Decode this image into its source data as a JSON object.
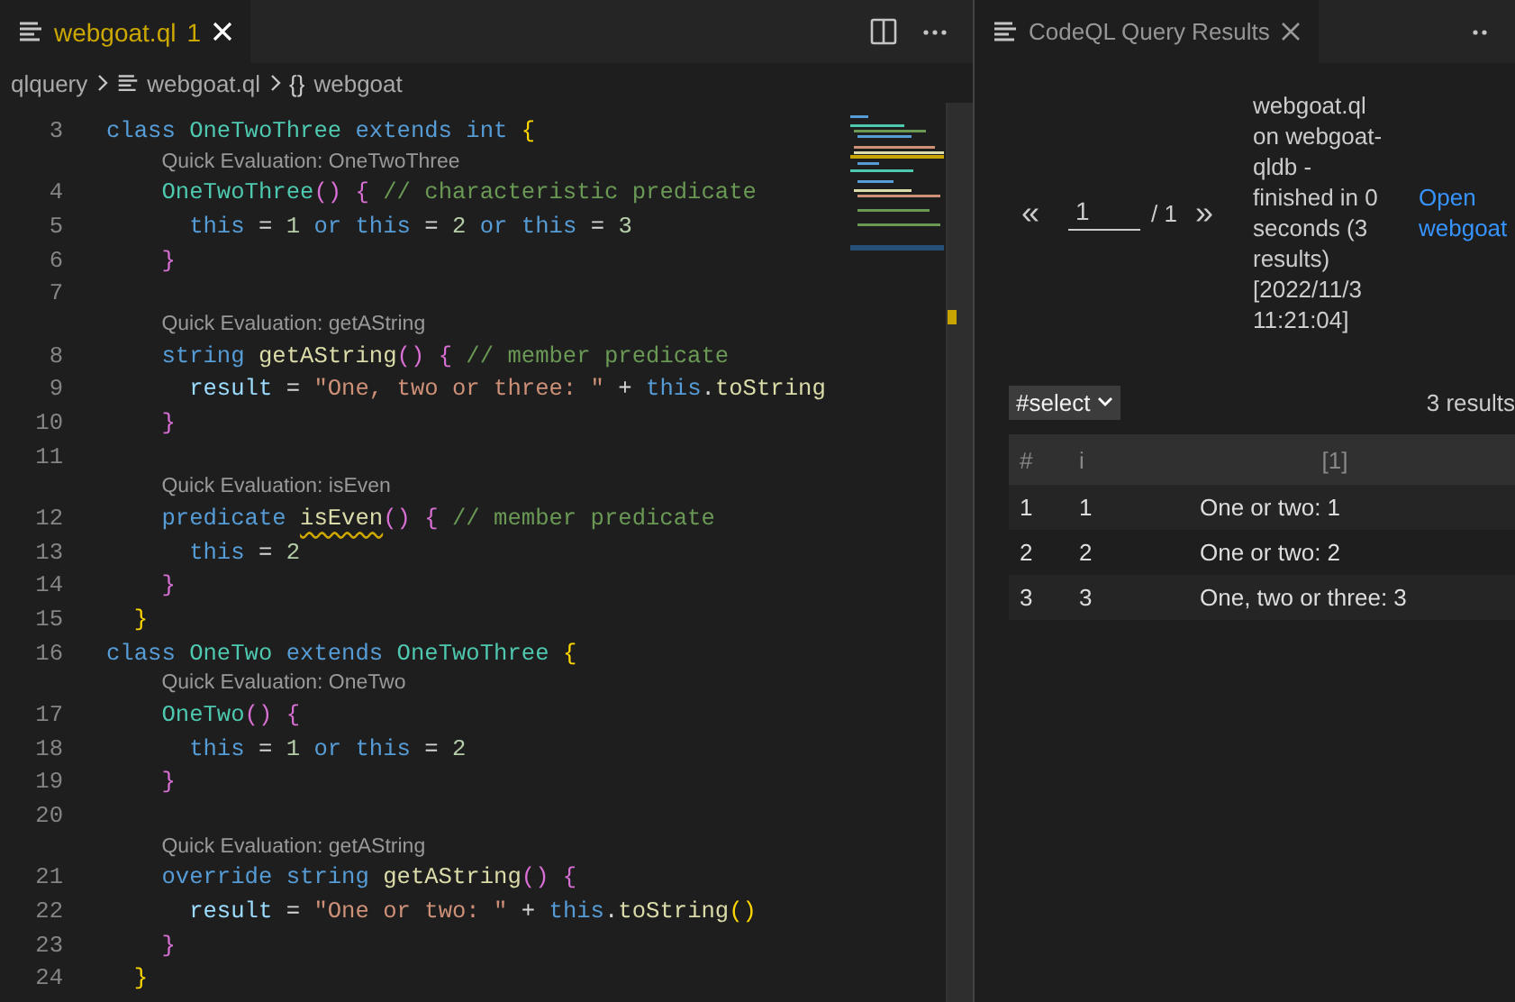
{
  "editor": {
    "tab": {
      "label": "webgoat.ql",
      "badge": "1",
      "selected": true
    },
    "breadcrumb": [
      {
        "kind": "folder",
        "label": "qlquery"
      },
      {
        "kind": "file",
        "label": "webgoat.ql"
      },
      {
        "kind": "symbol",
        "label": "webgoat",
        "glyph": "{}"
      }
    ],
    "lines": [
      {
        "kind": "code",
        "number": "3",
        "tokens": [
          {
            "kind": "keyword",
            "text": "class "
          },
          {
            "kind": "type",
            "text": "OneTwoThree "
          },
          {
            "kind": "keyword",
            "text": "extends int "
          },
          {
            "kind": "bracket1",
            "text": "{"
          }
        ]
      },
      {
        "kind": "lens",
        "text": "Quick Evaluation: OneTwoThree"
      },
      {
        "kind": "code",
        "number": "4",
        "tokens": [
          {
            "kind": "type",
            "text": "    OneTwoThree"
          },
          {
            "kind": "bracket2",
            "text": "() {"
          },
          {
            "kind": "comment",
            "text": " // characteristic predicate"
          }
        ]
      },
      {
        "kind": "code",
        "number": "5",
        "tokens": [
          {
            "kind": "keyword",
            "text": "      this"
          },
          {
            "kind": "plain",
            "text": " = "
          },
          {
            "kind": "number",
            "text": "1"
          },
          {
            "kind": "keyword",
            "text": " or this"
          },
          {
            "kind": "plain",
            "text": " = "
          },
          {
            "kind": "number",
            "text": "2"
          },
          {
            "kind": "keyword",
            "text": " or this"
          },
          {
            "kind": "plain",
            "text": " = "
          },
          {
            "kind": "number",
            "text": "3"
          }
        ]
      },
      {
        "kind": "code",
        "number": "6",
        "tokens": [
          {
            "kind": "bracket2",
            "text": "    }"
          }
        ]
      },
      {
        "kind": "code",
        "number": "7"
      },
      {
        "kind": "lens",
        "text": "Quick Evaluation: getAString"
      },
      {
        "kind": "code",
        "number": "8",
        "tokens": [
          {
            "kind": "keyword",
            "text": "    string "
          },
          {
            "kind": "function",
            "text": "getAString"
          },
          {
            "kind": "bracket2",
            "text": "() {"
          },
          {
            "kind": "comment",
            "text": " // member predicate"
          }
        ]
      },
      {
        "kind": "code",
        "number": "9",
        "tokens": [
          {
            "kind": "variable",
            "text": "      result"
          },
          {
            "kind": "plain",
            "text": " = "
          },
          {
            "kind": "string",
            "text": "\"One, two or three: \""
          },
          {
            "kind": "plain",
            "text": " + "
          },
          {
            "kind": "keyword",
            "text": "this"
          },
          {
            "kind": "plain",
            "text": "."
          },
          {
            "kind": "function",
            "text": "toString"
          }
        ]
      },
      {
        "kind": "code",
        "number": "10",
        "tokens": [
          {
            "kind": "bracket2",
            "text": "    }"
          }
        ]
      },
      {
        "kind": "code",
        "number": "11"
      },
      {
        "kind": "lens",
        "text": "Quick Evaluation: isEven"
      },
      {
        "kind": "code",
        "number": "12",
        "tokens": [
          {
            "kind": "keyword",
            "text": "    predicate "
          },
          {
            "kind": "function",
            "text": "isEven",
            "warn": true
          },
          {
            "kind": "bracket2",
            "text": "() {"
          },
          {
            "kind": "comment",
            "text": " // member predicate"
          }
        ]
      },
      {
        "kind": "code",
        "number": "13",
        "tokens": [
          {
            "kind": "keyword",
            "text": "      this"
          },
          {
            "kind": "plain",
            "text": " = "
          },
          {
            "kind": "number",
            "text": "2"
          }
        ]
      },
      {
        "kind": "code",
        "number": "14",
        "tokens": [
          {
            "kind": "bracket2",
            "text": "    }"
          }
        ]
      },
      {
        "kind": "code",
        "number": "15",
        "tokens": [
          {
            "kind": "bracket1",
            "text": "  }"
          }
        ]
      },
      {
        "kind": "code",
        "number": "16",
        "tokens": [
          {
            "kind": "keyword",
            "text": "class "
          },
          {
            "kind": "type",
            "text": "OneTwo "
          },
          {
            "kind": "keyword",
            "text": "extends "
          },
          {
            "kind": "type",
            "text": "OneTwoThree "
          },
          {
            "kind": "bracket1",
            "text": "{"
          }
        ]
      },
      {
        "kind": "lens",
        "text": "Quick Evaluation: OneTwo"
      },
      {
        "kind": "code",
        "number": "17",
        "tokens": [
          {
            "kind": "type",
            "text": "    OneTwo"
          },
          {
            "kind": "bracket2",
            "text": "() {"
          }
        ]
      },
      {
        "kind": "code",
        "number": "18",
        "tokens": [
          {
            "kind": "keyword",
            "text": "      this"
          },
          {
            "kind": "plain",
            "text": " = "
          },
          {
            "kind": "number",
            "text": "1"
          },
          {
            "kind": "keyword",
            "text": " or this"
          },
          {
            "kind": "plain",
            "text": " = "
          },
          {
            "kind": "number",
            "text": "2"
          }
        ]
      },
      {
        "kind": "code",
        "number": "19",
        "tokens": [
          {
            "kind": "bracket2",
            "text": "    }"
          }
        ]
      },
      {
        "kind": "code",
        "number": "20"
      },
      {
        "kind": "lens",
        "text": "Quick Evaluation: getAString"
      },
      {
        "kind": "code",
        "number": "21",
        "tokens": [
          {
            "kind": "keyword",
            "text": "    override string "
          },
          {
            "kind": "function",
            "text": "getAString"
          },
          {
            "kind": "bracket2",
            "text": "() {"
          }
        ]
      },
      {
        "kind": "code",
        "number": "22",
        "tokens": [
          {
            "kind": "variable",
            "text": "      result"
          },
          {
            "kind": "plain",
            "text": " = "
          },
          {
            "kind": "string",
            "text": "\"One or two: \""
          },
          {
            "kind": "plain",
            "text": " + "
          },
          {
            "kind": "keyword",
            "text": "this"
          },
          {
            "kind": "plain",
            "text": "."
          },
          {
            "kind": "function",
            "text": "toString"
          },
          {
            "kind": "bracket1",
            "text": "()"
          }
        ]
      },
      {
        "kind": "code",
        "number": "23",
        "tokens": [
          {
            "kind": "bracket2",
            "text": "    }"
          }
        ]
      },
      {
        "kind": "code",
        "number": "24",
        "tokens": [
          {
            "kind": "bracket1",
            "text": "  }"
          }
        ]
      }
    ]
  },
  "results": {
    "tab": {
      "label": "CodeQL Query Results",
      "selected": true
    },
    "pagination": {
      "prev": "«",
      "page": "1",
      "total": "/ 1",
      "next": "»"
    },
    "summary": "webgoat.ql on webgoat-qldb - finished in 0 seconds (3 results) [2022/11/3 11:21:04]",
    "link": "Open webgoat",
    "result_set": "#select",
    "count": "3 results",
    "table": {
      "columns": [
        "#",
        "i",
        "[1]"
      ],
      "rows": [
        [
          "1",
          "1",
          "One or two: 1"
        ],
        [
          "2",
          "2",
          "One or two: 2"
        ],
        [
          "3",
          "3",
          "One, two or three: 3"
        ]
      ]
    }
  }
}
